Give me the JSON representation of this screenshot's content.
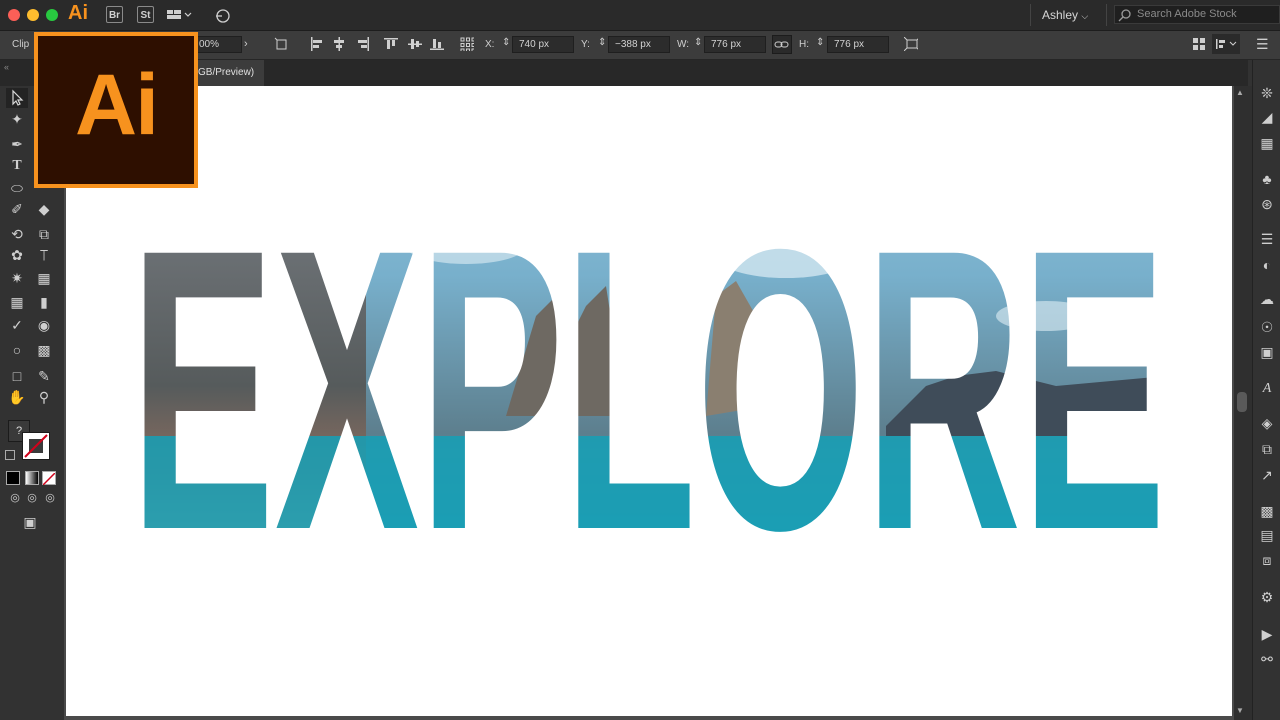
{
  "app": {
    "logo_small": "Ai",
    "bridge_label": "Br",
    "stock_label": "St",
    "user": "Ashley",
    "search_placeholder": "Search Adobe Stock",
    "logo_big": "Ai"
  },
  "control_bar": {
    "mode_label": "Clip",
    "opacity_value": "00%",
    "x_label": "X:",
    "x_value": "740 px",
    "y_label": "Y:",
    "y_value": "−388 px",
    "w_label": "W:",
    "w_value": "776 px",
    "h_label": "H:",
    "h_value": "776 px"
  },
  "document": {
    "tab_label": "GB/Preview)"
  },
  "artwork": {
    "headline": "EXPLORE"
  },
  "colors": {
    "accent": "#f7921e",
    "panel": "#323232",
    "artboard": "#ffffff"
  },
  "icons": {
    "toolbar": [
      "selection-icon",
      "magic-wand-icon",
      "pen-icon",
      "type-icon",
      "ellipse-icon",
      "paintbrush-icon",
      "eraser-icon",
      "rotate-icon",
      "scale-icon",
      "warp-icon",
      "pin-icon",
      "mesh-icon",
      "gradient-icon",
      "eyedropper-icon",
      "blend-icon",
      "symbol-sprayer-icon",
      "graph-icon",
      "artboard-icon",
      "slice-icon",
      "hand-icon",
      "zoom-icon"
    ],
    "right_dock": [
      "color-guide-icon",
      "gradient-panel-icon",
      "swatches-icon",
      "symbols-icon",
      "brushes-icon",
      "stroke-icon",
      "transparency-icon",
      "libraries-icon",
      "appearance-icon",
      "export-icon",
      "character-icon",
      "layers-icon",
      "artboards-panel-icon",
      "asset-export-icon",
      "align-icon",
      "pathfinder-icon",
      "transform-icon",
      "navigator-icon",
      "actions-icon",
      "links-icon"
    ]
  }
}
